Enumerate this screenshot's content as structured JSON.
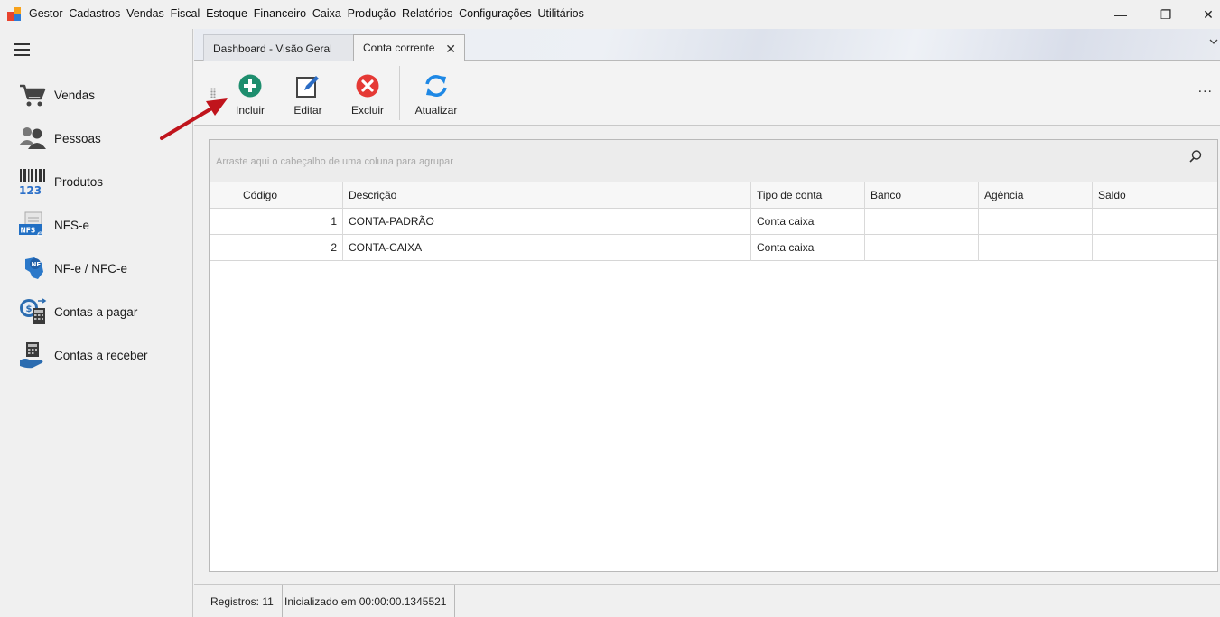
{
  "menubar": {
    "items": [
      "Gestor",
      "Cadastros",
      "Vendas",
      "Fiscal",
      "Estoque",
      "Financeiro",
      "Caixa",
      "Produção",
      "Relatórios",
      "Configurações",
      "Utilitários"
    ],
    "controls": {
      "minimize": "—",
      "restore": "❐",
      "close": "✕"
    }
  },
  "sidebar": {
    "items": [
      {
        "label": "Vendas",
        "icon": "cart-icon"
      },
      {
        "label": "Pessoas",
        "icon": "people-icon"
      },
      {
        "label": "Produtos",
        "icon": "barcode-icon"
      },
      {
        "label": "NFS-e",
        "icon": "nfse-icon"
      },
      {
        "label": "NF-e / NFC-e",
        "icon": "nfe-icon"
      },
      {
        "label": "Contas a pagar",
        "icon": "bill-pay-icon"
      },
      {
        "label": "Contas a receber",
        "icon": "bill-receive-icon"
      }
    ]
  },
  "tabs": [
    {
      "label": "Dashboard - Visão Geral",
      "active": false
    },
    {
      "label": "Conta corrente",
      "active": true,
      "close": "✕"
    }
  ],
  "toolbar": {
    "buttons": [
      {
        "label": "Incluir",
        "icon": "plus-circle-icon",
        "color": "#1e8e6e"
      },
      {
        "label": "Editar",
        "icon": "edit-icon",
        "color": "#2b6cc4"
      },
      {
        "label": "Excluir",
        "icon": "delete-circle-icon",
        "color": "#e53935"
      },
      {
        "label": "Atualizar",
        "icon": "refresh-icon",
        "color": "#1e88e5"
      }
    ],
    "more": "..."
  },
  "grid": {
    "group_placeholder": "Arraste aqui o cabeçalho de uma coluna para agrupar",
    "columns": [
      "Código",
      "Descrição",
      "Tipo de conta",
      "Banco",
      "Agência",
      "Saldo"
    ],
    "rows": [
      [
        "1",
        "CONTA-PADRÃO",
        "Conta caixa",
        "",
        "",
        ""
      ],
      [
        "2",
        "CONTA-CAIXA",
        "Conta caixa",
        "",
        "",
        ""
      ]
    ]
  },
  "status": {
    "records": "Registros: 11",
    "init": "Inicializado em 00:00:00.1345521"
  },
  "colors": {
    "annotation_arrow": "#c0141c"
  }
}
